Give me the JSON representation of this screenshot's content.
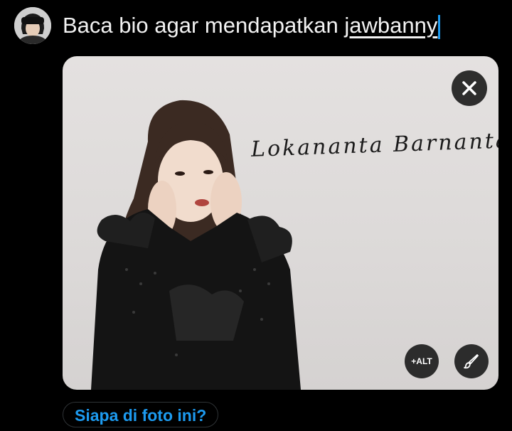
{
  "compose": {
    "text_before": "Baca bio agar mendapatkan ",
    "mention": "jawbanny"
  },
  "media": {
    "watermark_text": "Lokananta Barnantara",
    "alt_label": "+ALT",
    "close_icon": "close-icon",
    "edit_icon": "brush-icon"
  },
  "tag_people_label": "Siapa di foto ini?",
  "colors": {
    "accent": "#1d9bf0",
    "background": "#000000",
    "button_bg": "#141414"
  }
}
